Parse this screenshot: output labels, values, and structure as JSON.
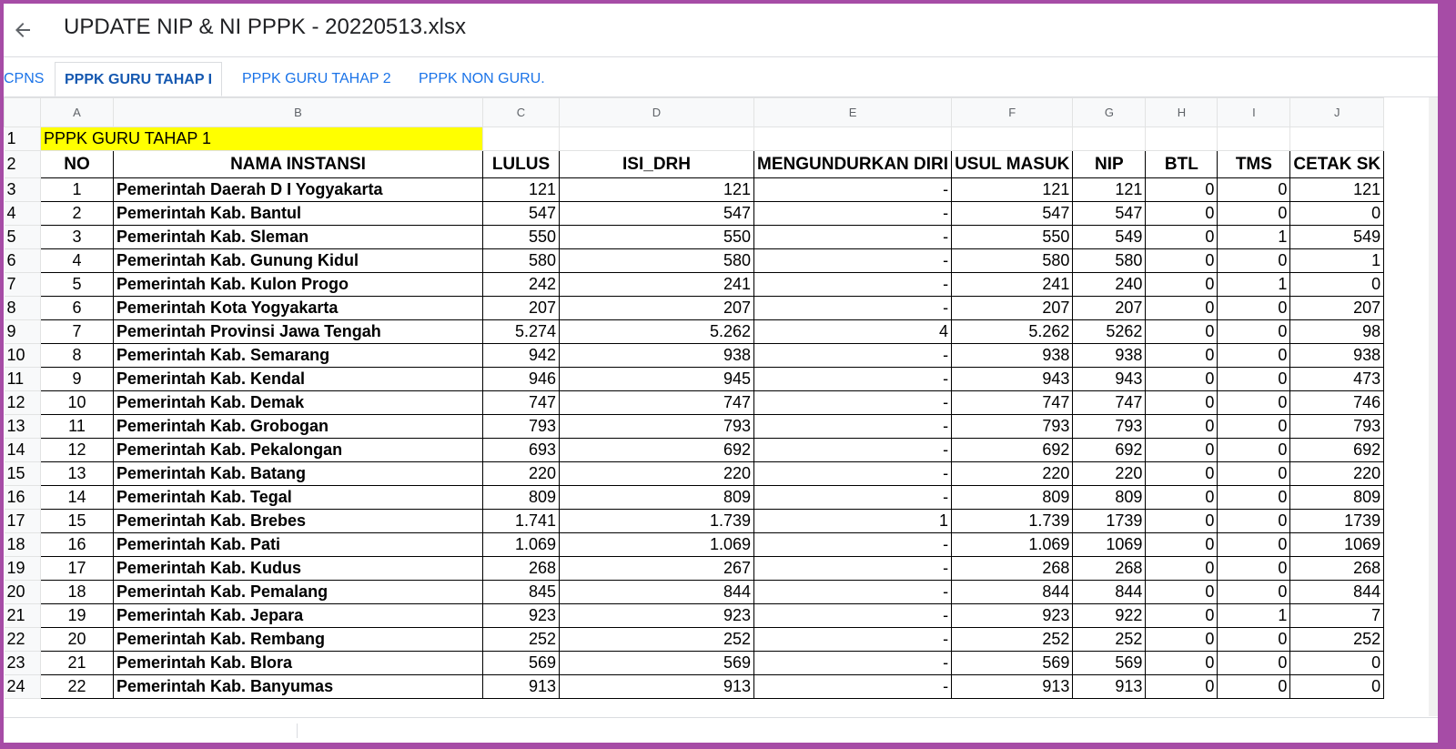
{
  "file_title": "UPDATE NIP & NI PPPK - 20220513.xlsx",
  "sheet_tabs": [
    {
      "label": "CPNS",
      "active": false
    },
    {
      "label": "PPPK GURU TAHAP I",
      "active": true
    },
    {
      "label": "PPPK GURU TAHAP 2",
      "active": false
    },
    {
      "label": "PPPK NON GURU.",
      "active": false
    }
  ],
  "column_letters": [
    "A",
    "B",
    "C",
    "D",
    "E",
    "F",
    "G",
    "H",
    "I",
    "J"
  ],
  "row_numbers": [
    "1",
    "2",
    "3",
    "4",
    "5",
    "6",
    "7",
    "8",
    "9",
    "10",
    "11",
    "12",
    "13",
    "14",
    "15",
    "16",
    "17",
    "18",
    "19",
    "20",
    "21",
    "22",
    "23",
    "24"
  ],
  "title_cell": "PPPK GURU TAHAP 1",
  "headers": [
    "NO",
    "NAMA INSTANSI",
    "LULUS",
    "ISI_DRH",
    "MENGUNDURKAN DIRI",
    "USUL MASUK",
    "NIP",
    "BTL",
    "TMS",
    "CETAK SK"
  ],
  "rows": [
    [
      "1",
      "Pemerintah Daerah D I Yogyakarta",
      "121",
      "121",
      "-",
      "121",
      "121",
      "0",
      "0",
      "121"
    ],
    [
      "2",
      "Pemerintah Kab. Bantul",
      "547",
      "547",
      "-",
      "547",
      "547",
      "0",
      "0",
      "0"
    ],
    [
      "3",
      "Pemerintah Kab. Sleman",
      "550",
      "550",
      "-",
      "550",
      "549",
      "0",
      "1",
      "549"
    ],
    [
      "4",
      "Pemerintah Kab. Gunung Kidul",
      "580",
      "580",
      "-",
      "580",
      "580",
      "0",
      "0",
      "1"
    ],
    [
      "5",
      "Pemerintah Kab. Kulon Progo",
      "242",
      "241",
      "-",
      "241",
      "240",
      "0",
      "1",
      "0"
    ],
    [
      "6",
      "Pemerintah Kota Yogyakarta",
      "207",
      "207",
      "-",
      "207",
      "207",
      "0",
      "0",
      "207"
    ],
    [
      "7",
      "Pemerintah Provinsi Jawa Tengah",
      "5.274",
      "5.262",
      "4",
      "5.262",
      "5262",
      "0",
      "0",
      "98"
    ],
    [
      "8",
      "Pemerintah Kab. Semarang",
      "942",
      "938",
      "-",
      "938",
      "938",
      "0",
      "0",
      "938"
    ],
    [
      "9",
      "Pemerintah Kab. Kendal",
      "946",
      "945",
      "-",
      "943",
      "943",
      "0",
      "0",
      "473"
    ],
    [
      "10",
      "Pemerintah Kab. Demak",
      "747",
      "747",
      "-",
      "747",
      "747",
      "0",
      "0",
      "746"
    ],
    [
      "11",
      "Pemerintah Kab. Grobogan",
      "793",
      "793",
      "-",
      "793",
      "793",
      "0",
      "0",
      "793"
    ],
    [
      "12",
      "Pemerintah Kab. Pekalongan",
      "693",
      "692",
      "-",
      "692",
      "692",
      "0",
      "0",
      "692"
    ],
    [
      "13",
      "Pemerintah Kab. Batang",
      "220",
      "220",
      "-",
      "220",
      "220",
      "0",
      "0",
      "220"
    ],
    [
      "14",
      "Pemerintah Kab. Tegal",
      "809",
      "809",
      "-",
      "809",
      "809",
      "0",
      "0",
      "809"
    ],
    [
      "15",
      "Pemerintah Kab. Brebes",
      "1.741",
      "1.739",
      "1",
      "1.739",
      "1739",
      "0",
      "0",
      "1739"
    ],
    [
      "16",
      "Pemerintah Kab. Pati",
      "1.069",
      "1.069",
      "-",
      "1.069",
      "1069",
      "0",
      "0",
      "1069"
    ],
    [
      "17",
      "Pemerintah Kab. Kudus",
      "268",
      "267",
      "-",
      "268",
      "268",
      "0",
      "0",
      "268"
    ],
    [
      "18",
      "Pemerintah Kab. Pemalang",
      "845",
      "844",
      "-",
      "844",
      "844",
      "0",
      "0",
      "844"
    ],
    [
      "19",
      "Pemerintah Kab. Jepara",
      "923",
      "923",
      "-",
      "923",
      "922",
      "0",
      "1",
      "7"
    ],
    [
      "20",
      "Pemerintah Kab. Rembang",
      "252",
      "252",
      "-",
      "252",
      "252",
      "0",
      "0",
      "252"
    ],
    [
      "21",
      "Pemerintah Kab. Blora",
      "569",
      "569",
      "-",
      "569",
      "569",
      "0",
      "0",
      "0"
    ],
    [
      "22",
      "Pemerintah Kab. Banyumas",
      "913",
      "913",
      "-",
      "913",
      "913",
      "0",
      "0",
      "0"
    ]
  ]
}
